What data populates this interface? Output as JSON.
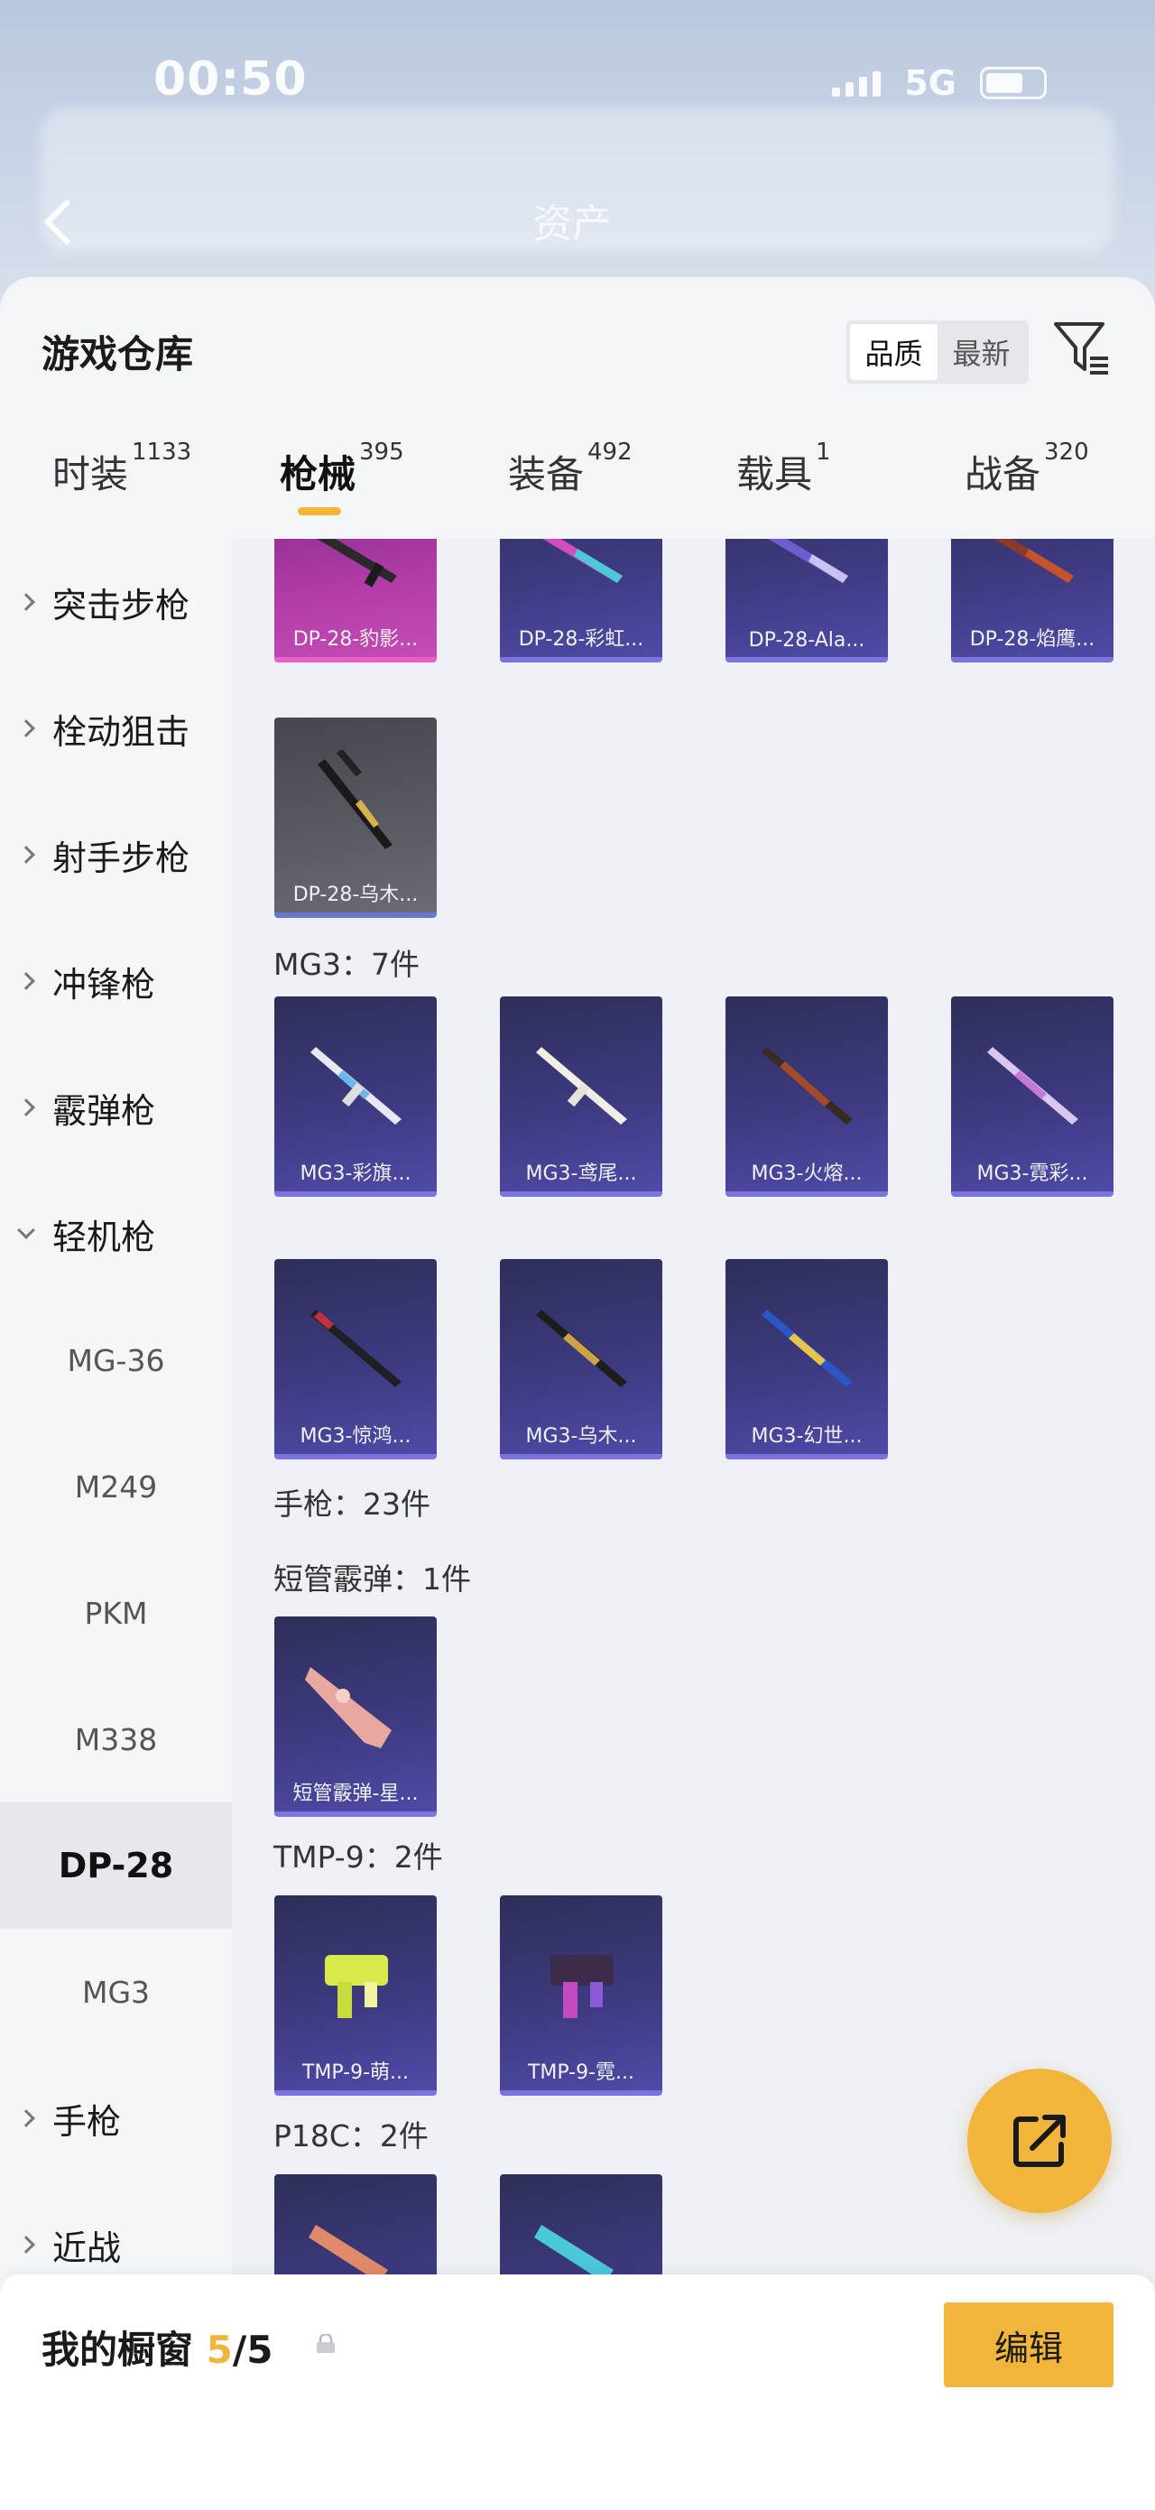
{
  "status_bar": {
    "time": "00:50",
    "network": "5G"
  },
  "background_header": {
    "title": "资产"
  },
  "warehouse": {
    "title": "游戏仓库",
    "sort_options": [
      "品质",
      "最新"
    ],
    "sort_selected": "品质",
    "tabs": [
      {
        "label": "时装",
        "count": "1133"
      },
      {
        "label": "枪械",
        "count": "395",
        "active": true
      },
      {
        "label": "装备",
        "count": "492"
      },
      {
        "label": "载具",
        "count": "1"
      },
      {
        "label": "战备",
        "count": "320"
      }
    ]
  },
  "sidebar": {
    "categories": [
      "突击步枪",
      "栓动狙击",
      "射手步枪",
      "冲锋枪",
      "霰弹枪",
      "轻机枪"
    ],
    "expanded_subitems": [
      "MG-36",
      "M249",
      "PKM",
      "M338",
      "DP-28",
      "MG3"
    ],
    "selected_subitem": "DP-28",
    "after_categories": [
      "手枪",
      "近战"
    ]
  },
  "grid": {
    "dp28_row1": [
      "DP-28-豹影...",
      "DP-28-彩虹...",
      "DP-28-Ala...",
      "DP-28-焰鹰..."
    ],
    "dp28_row2": [
      "DP-28-乌木..."
    ],
    "mg3_label": "MG3：7件",
    "mg3_items": [
      "MG3-彩旗...",
      "MG3-鸢尾...",
      "MG3-火熔...",
      "MG3-霓彩...",
      "MG3-惊鸿...",
      "MG3-乌木...",
      "MG3-幻世..."
    ],
    "pistol_label": "手枪：23件",
    "shotgun_label": "短管霰弹：1件",
    "shotgun_items": [
      "短管霰弹-星..."
    ],
    "tmp9_label": "TMP-9：2件",
    "tmp9_items": [
      "TMP-9-萌...",
      "TMP-9-霓..."
    ],
    "p18c_label": "P18C：2件"
  },
  "showcase": {
    "label": "我的橱窗",
    "count": "5",
    "total": "/5",
    "edit_label": "编辑"
  },
  "colors": {
    "accent": "#f2b53c",
    "card_purple": "#3d3a80",
    "card_pink": "#b03aa8"
  }
}
